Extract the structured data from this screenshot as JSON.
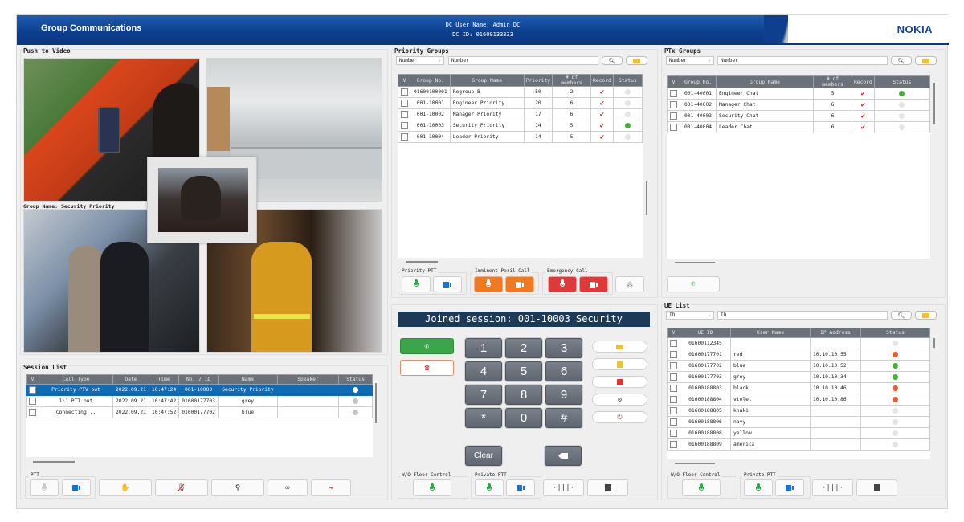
{
  "header": {
    "title": "Group Communications",
    "user_line": "DC User Name: Admin DC",
    "id_line": "DC ID: 01600133333",
    "logo": "NOKIA"
  },
  "push_to_video": {
    "title": "Push to Video",
    "group_name_label": "Group Name: Security Priority"
  },
  "priority_groups": {
    "title": "Priority Groups",
    "filter_select": "Number",
    "search_value": "Number",
    "columns": [
      "V",
      "Group No.",
      "Group Name",
      "Priority",
      "# of members",
      "Record",
      "Status"
    ],
    "rows": [
      {
        "no": "01600100001",
        "name": "Regroup B",
        "priority": "50",
        "members": "2",
        "record": true,
        "status": "idle"
      },
      {
        "no": "001-10001",
        "name": "Engineer Priority",
        "priority": "20",
        "members": "6",
        "record": true,
        "status": "idle"
      },
      {
        "no": "001-10002",
        "name": "Manager Priority",
        "priority": "17",
        "members": "6",
        "record": true,
        "status": "idle"
      },
      {
        "no": "001-10003",
        "name": "Security Priority",
        "priority": "14",
        "members": "5",
        "record": true,
        "status": "active"
      },
      {
        "no": "001-10004",
        "name": "Leader Priority",
        "priority": "14",
        "members": "5",
        "record": true,
        "status": "idle"
      }
    ],
    "buttons": {
      "priority_ptt_label": "Priority PTT",
      "imminent_peril_label": "Imminent Peril Call",
      "emergency_label": "Emergency Call"
    }
  },
  "ptx_groups": {
    "title": "PTx Groups",
    "filter_select": "Number",
    "search_value": "Number",
    "columns": [
      "V",
      "Group No.",
      "Group Name",
      "# of members",
      "Record",
      "Status"
    ],
    "rows": [
      {
        "no": "001-40001",
        "name": "Engineer Chat",
        "members": "5",
        "record": true,
        "status": "active"
      },
      {
        "no": "001-40002",
        "name": "Manager Chat",
        "members": "6",
        "record": true,
        "status": "idle"
      },
      {
        "no": "001-40003",
        "name": "Security Chat",
        "members": "6",
        "record": true,
        "status": "idle"
      },
      {
        "no": "001-40004",
        "name": "Leader Chat",
        "members": "6",
        "record": true,
        "status": "idle"
      }
    ]
  },
  "session_list": {
    "title": "Session List",
    "columns": [
      "V",
      "Call Type",
      "Date",
      "Time",
      "No. / ID",
      "Name",
      "Speaker",
      "Status"
    ],
    "rows": [
      {
        "type": "Priority PTV out",
        "date": "2022.09.21",
        "time": "10:47:24",
        "id": "001-10003",
        "name": "Security Priority",
        "speaker": "",
        "selected": true
      },
      {
        "type": "1:1 PTT out",
        "date": "2022.09.21",
        "time": "10:47:42",
        "id": "01600177703",
        "name": "grey",
        "speaker": "",
        "selected": false
      },
      {
        "type": "Connecting...",
        "date": "2022.09.21",
        "time": "10:47:52",
        "id": "01600177702",
        "name": "blue",
        "speaker": "",
        "selected": false
      }
    ],
    "ptt_label": "PTT"
  },
  "dialer": {
    "session_banner": "Joined session: 001-10003 Security",
    "keys": [
      "1",
      "2",
      "3",
      "4",
      "5",
      "6",
      "7",
      "8",
      "9",
      "*",
      "0",
      "#"
    ],
    "clear_label": "Clear",
    "wo_floor_label": "W/O Floor Control",
    "private_ptt_label": "Private PTT"
  },
  "ue_list": {
    "title": "UE List",
    "filter_select": "ID",
    "search_value": "ID",
    "columns": [
      "V",
      "UE ID",
      "User Name",
      "IP Address",
      "Status"
    ],
    "rows": [
      {
        "id": "01600112345",
        "name": "",
        "ip": "",
        "status": "idle"
      },
      {
        "id": "01600177701",
        "name": "red",
        "ip": "10.10.10.55",
        "status": "busy"
      },
      {
        "id": "01600177702",
        "name": "blue",
        "ip": "10.10.10.52",
        "status": "active"
      },
      {
        "id": "01600177703",
        "name": "grey",
        "ip": "10.10.10.34",
        "status": "active"
      },
      {
        "id": "01600188803",
        "name": "black",
        "ip": "10.10.10.46",
        "status": "busy"
      },
      {
        "id": "01600188804",
        "name": "violet",
        "ip": "10.10.10.86",
        "status": "busy"
      },
      {
        "id": "01600188805",
        "name": "khaki",
        "ip": "",
        "status": "idle"
      },
      {
        "id": "01600188806",
        "name": "navy",
        "ip": "",
        "status": "idle"
      },
      {
        "id": "01600188808",
        "name": "yellow",
        "ip": "",
        "status": "idle"
      },
      {
        "id": "01600188809",
        "name": "america",
        "ip": "",
        "status": "idle"
      }
    ],
    "wo_floor_label": "W/O Floor Control",
    "private_ptt_label": "Private PTT"
  },
  "colors": {
    "header_blue": "#0d3f8e",
    "status_active": "#3cb82e",
    "status_busy": "#ef5a2f",
    "status_idle": "#e4e4e4",
    "record_check": "#e02020",
    "selected_row": "#0f6bb8",
    "green_button": "#3aa54a",
    "orange_button": "#f07a23",
    "red_button": "#de3a3a",
    "icon_blue": "#1a6fd8",
    "icon_green": "#2ca84a"
  }
}
